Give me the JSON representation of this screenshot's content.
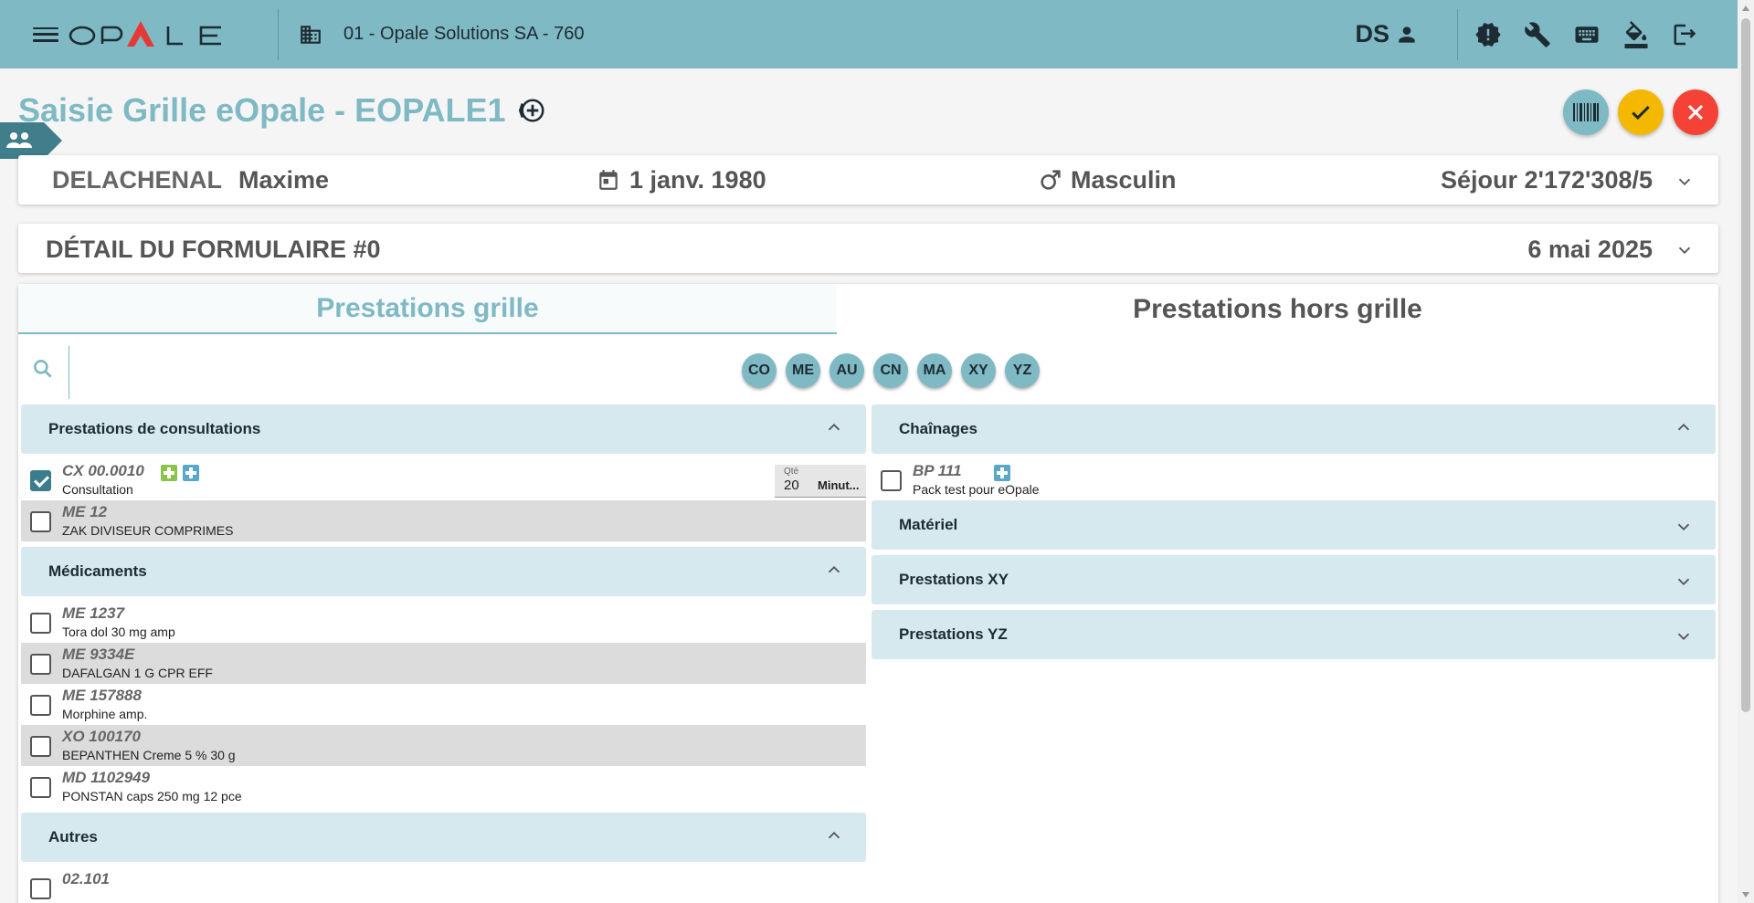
{
  "app": {
    "logo_text": "OPALE"
  },
  "header": {
    "company": "01 -  Opale Solutions SA - 760",
    "user_initials": "DS"
  },
  "page": {
    "title": "Saisie Grille eOpale - EOPALE1"
  },
  "patient": {
    "last_name": "DELACHENAL",
    "first_name": "Maxime",
    "birth_date": "1 janv. 1980",
    "sex": "Masculin",
    "stay": "Séjour 2'172'308/5"
  },
  "form_detail": {
    "title": "DÉTAIL DU FORMULAIRE #0",
    "date": "6 mai 2025"
  },
  "tabs": [
    {
      "label": "Prestations grille",
      "active": true
    },
    {
      "label": "Prestations hors grille",
      "active": false
    }
  ],
  "search": {
    "placeholder": ""
  },
  "filter_chips": [
    "CO",
    "ME",
    "AU",
    "CN",
    "MA",
    "XY",
    "YZ"
  ],
  "left_sections": [
    {
      "title": "Prestations de consultations",
      "expanded": true,
      "items": [
        {
          "code": "CX 00.0010",
          "desc": "Consultation",
          "checked": true,
          "qty_label": "Qté",
          "qty": "20",
          "unit": "Minut..."
        },
        {
          "code": "ME 12",
          "desc": "ZAK DIVISEUR COMPRIMES",
          "checked": false
        }
      ]
    },
    {
      "title": "Médicaments",
      "expanded": true,
      "items": [
        {
          "code": "ME 1237",
          "desc": "Tora dol 30 mg amp",
          "checked": false
        },
        {
          "code": "ME 9334E",
          "desc": "DAFALGAN 1 G CPR EFF",
          "checked": false
        },
        {
          "code": "ME 157888",
          "desc": "Morphine amp.",
          "checked": false
        },
        {
          "code": "XO 100170",
          "desc": "BEPANTHEN Creme 5 % 30 g",
          "checked": false
        },
        {
          "code": "MD 1102949",
          "desc": "PONSTAN caps 250 mg 12 pce",
          "checked": false
        }
      ]
    },
    {
      "title": "Autres",
      "expanded": true,
      "items": [
        {
          "code": "02.101",
          "desc": "",
          "checked": false
        }
      ]
    }
  ],
  "right_sections": [
    {
      "title": "Chaînages",
      "expanded": true,
      "items": [
        {
          "code": "BP 111",
          "desc": "Pack test pour eOpale",
          "checked": false
        }
      ]
    },
    {
      "title": "Matériel",
      "expanded": false
    },
    {
      "title": "Prestations XY",
      "expanded": false
    },
    {
      "title": "Prestations YZ",
      "expanded": false
    }
  ],
  "colors": {
    "accent": "#7fb9c4",
    "section_bg": "#d6e9ee",
    "confirm": "#f5b800",
    "cancel": "#f44336"
  }
}
